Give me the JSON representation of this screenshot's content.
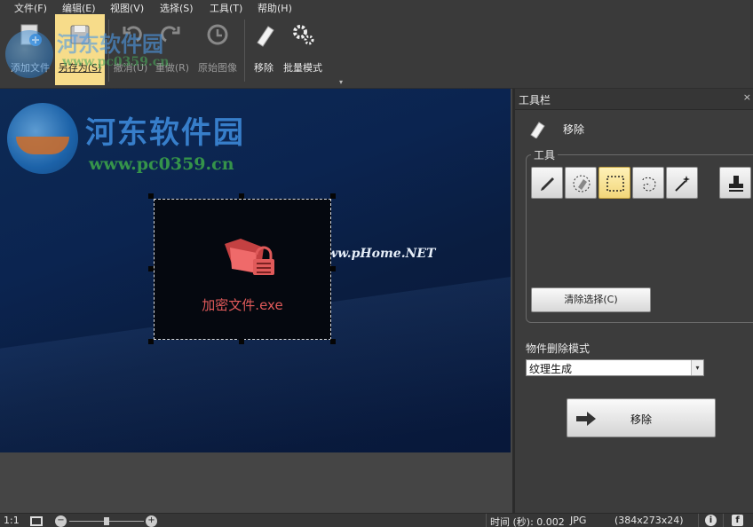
{
  "menu": [
    {
      "label": "文件(F)"
    },
    {
      "label": "编辑(E)"
    },
    {
      "label": "视图(V)"
    },
    {
      "label": "选择(S)"
    },
    {
      "label": "工具(T)"
    },
    {
      "label": "帮助(H)"
    }
  ],
  "toolbar": {
    "add_file": "添加文件",
    "save_as": "另存为(S)",
    "undo": "撤消(U)",
    "redo": "重做(R)",
    "original": "原始图像",
    "remove": "移除",
    "batch": "批量模式"
  },
  "canvas": {
    "watermark_title": "河东软件园",
    "watermark_url": "www.pc0359.cn",
    "watermark_phome": "www.pHome.NET",
    "selected_object_label": "加密文件.exe"
  },
  "panel": {
    "title": "工具栏",
    "close": "×",
    "section_title": "移除",
    "tools_group_label": "工具",
    "clear_selection": "清除选择(C)",
    "mode_label": "物件删除模式",
    "mode_value": "纹理生成",
    "remove_button": "移除"
  },
  "statusbar": {
    "zoom_ratio": "1:1",
    "time_label": "时间 (秒): 0.002",
    "format": "JPG",
    "dimensions": "(384x273x24)"
  },
  "colors": {
    "accent_active": "#f7dc8a",
    "selection_label": "#e05a5a"
  }
}
